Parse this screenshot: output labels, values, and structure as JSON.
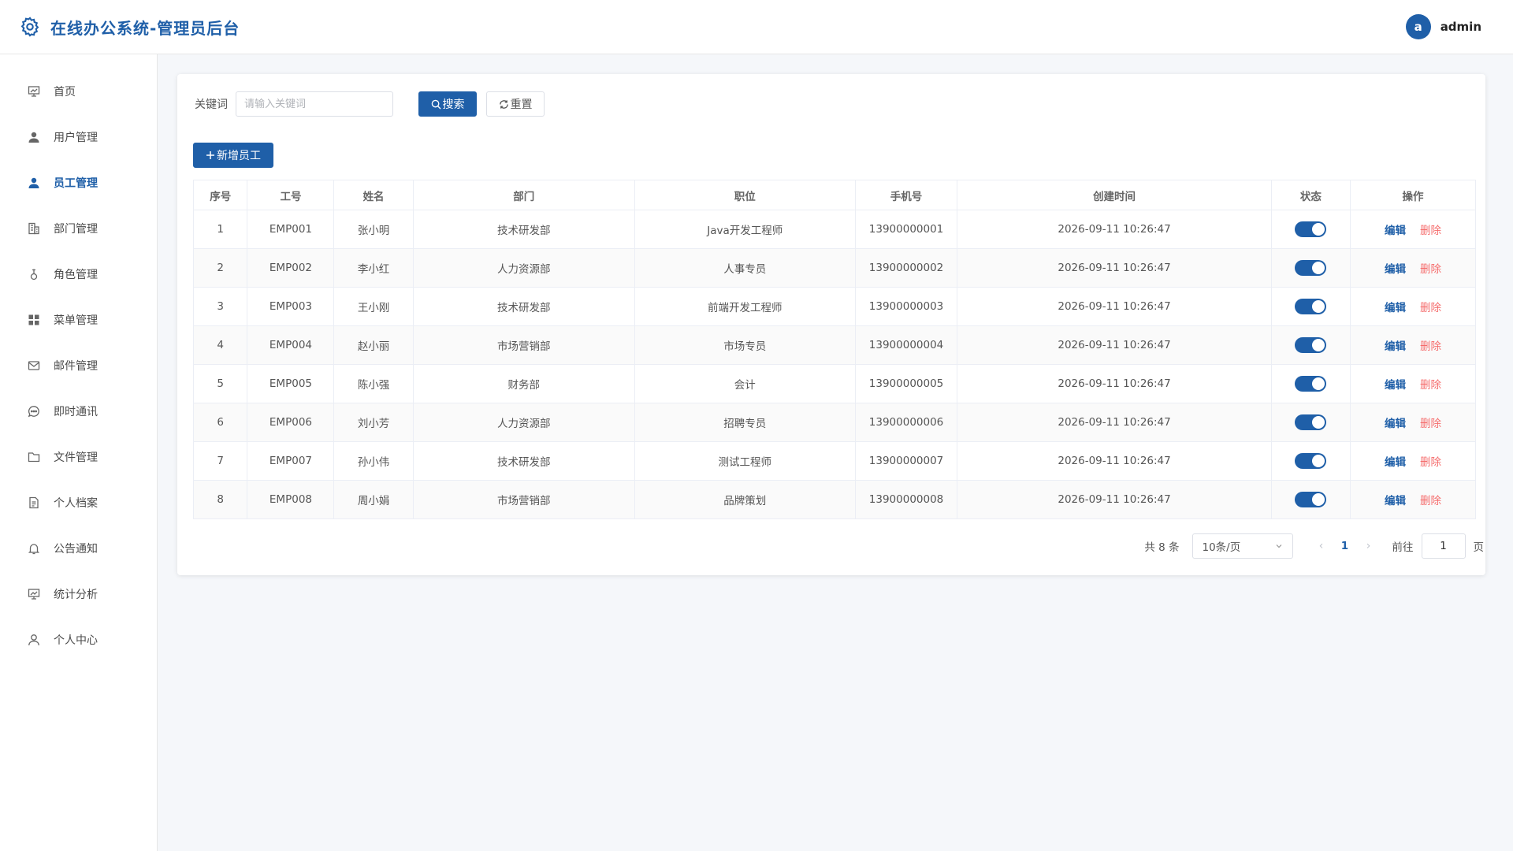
{
  "header": {
    "title": "在线办公系统-管理员后台",
    "avatar_letter": "a",
    "username": "admin"
  },
  "sidebar": {
    "items": [
      {
        "label": "首页",
        "icon": "dashboard-icon"
      },
      {
        "label": "用户管理",
        "icon": "user-icon"
      },
      {
        "label": "员工管理",
        "icon": "user-icon",
        "active": true
      },
      {
        "label": "部门管理",
        "icon": "building-icon"
      },
      {
        "label": "角色管理",
        "icon": "role-icon"
      },
      {
        "label": "菜单管理",
        "icon": "menu-grid-icon"
      },
      {
        "label": "邮件管理",
        "icon": "mail-icon"
      },
      {
        "label": "即时通讯",
        "icon": "chat-icon"
      },
      {
        "label": "文件管理",
        "icon": "folder-icon"
      },
      {
        "label": "个人档案",
        "icon": "document-icon"
      },
      {
        "label": "公告通知",
        "icon": "bell-icon"
      },
      {
        "label": "统计分析",
        "icon": "chart-icon"
      },
      {
        "label": "个人中心",
        "icon": "person-icon"
      }
    ]
  },
  "search": {
    "label": "关键词",
    "placeholder": "请输入关键词",
    "search_button": "搜索",
    "reset_button": "重置"
  },
  "add_button": "新增员工",
  "table": {
    "columns": [
      "序号",
      "工号",
      "姓名",
      "部门",
      "职位",
      "手机号",
      "创建时间",
      "状态",
      "操作"
    ],
    "edit_label": "编辑",
    "delete_label": "删除",
    "rows": [
      {
        "no": "1",
        "emp_id": "EMP001",
        "name": "张小明",
        "dept": "技术研发部",
        "position": "Java开发工程师",
        "phone": "13900000001",
        "created": "2026-09-11 10:26:47",
        "status": true
      },
      {
        "no": "2",
        "emp_id": "EMP002",
        "name": "李小红",
        "dept": "人力资源部",
        "position": "人事专员",
        "phone": "13900000002",
        "created": "2026-09-11 10:26:47",
        "status": true
      },
      {
        "no": "3",
        "emp_id": "EMP003",
        "name": "王小刚",
        "dept": "技术研发部",
        "position": "前端开发工程师",
        "phone": "13900000003",
        "created": "2026-09-11 10:26:47",
        "status": true
      },
      {
        "no": "4",
        "emp_id": "EMP004",
        "name": "赵小丽",
        "dept": "市场营销部",
        "position": "市场专员",
        "phone": "13900000004",
        "created": "2026-09-11 10:26:47",
        "status": true
      },
      {
        "no": "5",
        "emp_id": "EMP005",
        "name": "陈小强",
        "dept": "财务部",
        "position": "会计",
        "phone": "13900000005",
        "created": "2026-09-11 10:26:47",
        "status": true
      },
      {
        "no": "6",
        "emp_id": "EMP006",
        "name": "刘小芳",
        "dept": "人力资源部",
        "position": "招聘专员",
        "phone": "13900000006",
        "created": "2026-09-11 10:26:47",
        "status": true
      },
      {
        "no": "7",
        "emp_id": "EMP007",
        "name": "孙小伟",
        "dept": "技术研发部",
        "position": "测试工程师",
        "phone": "13900000007",
        "created": "2026-09-11 10:26:47",
        "status": true
      },
      {
        "no": "8",
        "emp_id": "EMP008",
        "name": "周小娟",
        "dept": "市场营销部",
        "position": "品牌策划",
        "phone": "13900000008",
        "created": "2026-09-11 10:26:47",
        "status": true
      }
    ]
  },
  "pagination": {
    "total_text": "共 8 条",
    "page_size": "10条/页",
    "current_page": "1",
    "goto_label": "前往",
    "goto_value": "1",
    "page_suffix": "页"
  },
  "colors": {
    "primary": "#1f5fa8",
    "danger": "#f56c6c",
    "background": "#f5f7fa"
  }
}
